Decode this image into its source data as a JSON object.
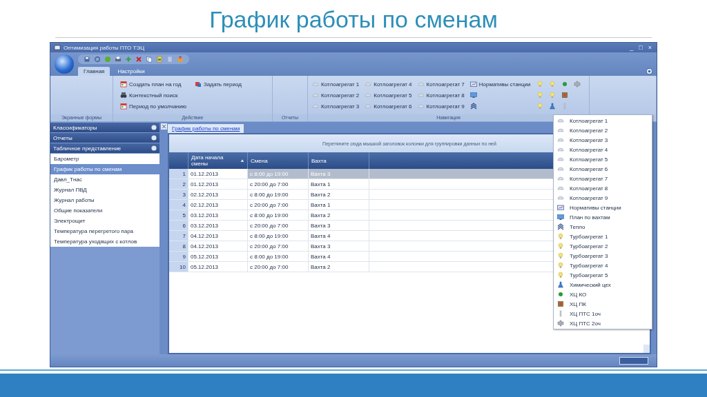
{
  "slide_title": "График работы по сменам",
  "window": {
    "title": "Оптимизация работы ПТО ТЭЦ",
    "controls": [
      "_",
      "□",
      "×"
    ]
  },
  "tabs": [
    {
      "label": "Главная",
      "selected": true
    },
    {
      "label": "Настройки",
      "selected": false
    }
  ],
  "ribbon": {
    "groups": [
      {
        "label": "Экранные формы",
        "kind": "empty"
      },
      {
        "label": "Действие",
        "kind": "actions",
        "items": [
          {
            "kind": "calendar",
            "label": "Создать план на год"
          },
          {
            "kind": "binoculars",
            "label": "Контекстный поиск"
          },
          {
            "kind": "calendar",
            "label": "Период по умолчанию"
          },
          {
            "kind": "period",
            "label": "Задать период"
          }
        ]
      },
      {
        "label": "Отчеты",
        "kind": "empty"
      },
      {
        "label": "Навигация",
        "kind": "navigation",
        "items": [
          {
            "kind": "boiler",
            "label": "Котлоагрегат 1"
          },
          {
            "kind": "boiler",
            "label": "Котлоагрегат 2"
          },
          {
            "kind": "boiler",
            "label": "Котлоагрегат 3"
          },
          {
            "kind": "boiler",
            "label": "Котлоагрегат 4"
          },
          {
            "kind": "boiler",
            "label": "Котлоагрегат 5"
          },
          {
            "kind": "boiler",
            "label": "Котлоагрегат 6"
          },
          {
            "kind": "boiler",
            "label": "Котлоагрегат 7"
          },
          {
            "kind": "boiler",
            "label": "Котлоагрегат 8"
          },
          {
            "kind": "boiler",
            "label": "Котлоагрегат 9"
          },
          {
            "kind": "norms",
            "label": "Нормативы станции"
          },
          {
            "kind": "plan"
          },
          {
            "kind": "heat"
          },
          {
            "kind": "bulb"
          },
          {
            "kind": "bulb"
          },
          {
            "kind": "bulb"
          },
          {
            "kind": "bulb"
          },
          {
            "kind": "bulb"
          },
          {
            "kind": "flask"
          },
          {
            "kind": "dot"
          },
          {
            "kind": "box"
          },
          {
            "kind": "column"
          },
          {
            "kind": "pipe"
          }
        ]
      },
      {
        "kind": "empty"
      }
    ]
  },
  "sidebar": {
    "sections": [
      "Классификаторы",
      "Отчеты",
      "Табличное представление"
    ],
    "items": [
      {
        "label": "Барометр",
        "selected": false
      },
      {
        "label": "График работы по сменам",
        "selected": true
      },
      {
        "label": "Давл_Тнас",
        "selected": false
      },
      {
        "label": "Журнал ПВД",
        "selected": false
      },
      {
        "label": "Журнал работы",
        "selected": false
      },
      {
        "label": "Общие показатели",
        "selected": false
      },
      {
        "label": "Электрощит",
        "selected": false
      },
      {
        "label": "Температура перегретого пара",
        "selected": false
      },
      {
        "label": "Температура уходящих с котлов",
        "selected": false
      }
    ]
  },
  "document_tab": "График работы по сменам",
  "group_hint": "Перетяните сюда мышкой заголовок колонки для группировки данных по ней",
  "table": {
    "columns": [
      "Дата начала смены",
      "Смена",
      "Вахта"
    ],
    "rows": [
      {
        "n": "1",
        "cells": [
          "01.12.2013",
          "с 8:00 до 19:00",
          "Вахта 3"
        ],
        "selected": true
      },
      {
        "n": "2",
        "cells": [
          "01.12.2013",
          "с 20:00 до 7:00",
          "Вахта 1"
        ],
        "selected": false
      },
      {
        "n": "3",
        "cells": [
          "02.12.2013",
          "с 8:00 до 19:00",
          "Вахта 2"
        ],
        "selected": false
      },
      {
        "n": "4",
        "cells": [
          "02.12.2013",
          "с 20:00 до 7:00",
          "Вахта 1"
        ],
        "selected": false
      },
      {
        "n": "5",
        "cells": [
          "03.12.2013",
          "с 8:00 до 19:00",
          "Вахта 2"
        ],
        "selected": false
      },
      {
        "n": "6",
        "cells": [
          "03.12.2013",
          "с 20:00 до 7:00",
          "Вахта 3"
        ],
        "selected": false
      },
      {
        "n": "7",
        "cells": [
          "04.12.2013",
          "с 8:00 до 19:00",
          "Вахта 4"
        ],
        "selected": false
      },
      {
        "n": "8",
        "cells": [
          "04.12.2013",
          "с 20:00 до 7:00",
          "Вахта 3"
        ],
        "selected": false
      },
      {
        "n": "9",
        "cells": [
          "05.12.2013",
          "с 8:00 до 19:00",
          "Вахта 4"
        ],
        "selected": false
      },
      {
        "n": "10",
        "cells": [
          "05.12.2013",
          "с 20:00 до 7:00",
          "Вахта 2"
        ],
        "selected": false
      }
    ]
  },
  "dropdown": [
    {
      "kind": "boiler",
      "label": "Котлоагрегат 1"
    },
    {
      "kind": "boiler",
      "label": "Котлоагрегат 2"
    },
    {
      "kind": "boiler",
      "label": "Котлоагрегат 3"
    },
    {
      "kind": "boiler",
      "label": "Котлоагрегат 4"
    },
    {
      "kind": "boiler",
      "label": "Котлоагрегат 5"
    },
    {
      "kind": "boiler",
      "label": "Котлоагрегат 6"
    },
    {
      "kind": "boiler",
      "label": "Котлоагрегат 7"
    },
    {
      "kind": "boiler",
      "label": "Котлоагрегат 8"
    },
    {
      "kind": "boiler",
      "label": "Котлоагрегат 9"
    },
    {
      "kind": "norms",
      "label": "Нормативы станции"
    },
    {
      "kind": "plan",
      "label": "План по вахтам"
    },
    {
      "kind": "heat",
      "label": "Тепло"
    },
    {
      "kind": "bulb",
      "label": "Турбоагрегат 1"
    },
    {
      "kind": "bulb",
      "label": "Турбоагрегат 2"
    },
    {
      "kind": "bulb",
      "label": "Турбоагрегат 3"
    },
    {
      "kind": "bulb",
      "label": "Турбоагрегат 4"
    },
    {
      "kind": "bulb",
      "label": "Турбоагрегат 5"
    },
    {
      "kind": "flask",
      "label": "Химический цех"
    },
    {
      "kind": "dot",
      "label": "ХЦ КО"
    },
    {
      "kind": "box",
      "label": "ХЦ ПК"
    },
    {
      "kind": "column",
      "label": "ХЦ ПТС 1оч"
    },
    {
      "kind": "pipe",
      "label": "ХЦ ПТС 2оч"
    }
  ]
}
